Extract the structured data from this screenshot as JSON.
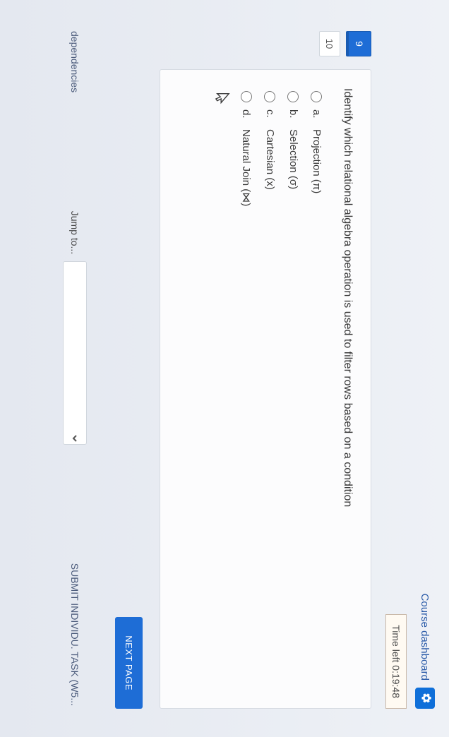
{
  "header": {
    "dashboard_link": "Course dashboard"
  },
  "timer": {
    "label": "Time left 0:19:48"
  },
  "qnav": {
    "current": "9",
    "next": "10"
  },
  "question": {
    "text": "Identify which relational algebra operation is used to filter rows based on a condition",
    "options": [
      {
        "letter": "a.",
        "label": "Projection (π)"
      },
      {
        "letter": "b.",
        "label": "Selection (σ)"
      },
      {
        "letter": "c.",
        "label": "Cartesian (x)"
      },
      {
        "letter": "d.",
        "label": "Natural Join (⋈)"
      }
    ]
  },
  "buttons": {
    "next": "NEXT PAGE"
  },
  "bottom": {
    "prev_link": "dependencies",
    "jump_label": "Jump to...",
    "next_link": "SUBMIT INDIVIDU. TASK (W5..."
  }
}
